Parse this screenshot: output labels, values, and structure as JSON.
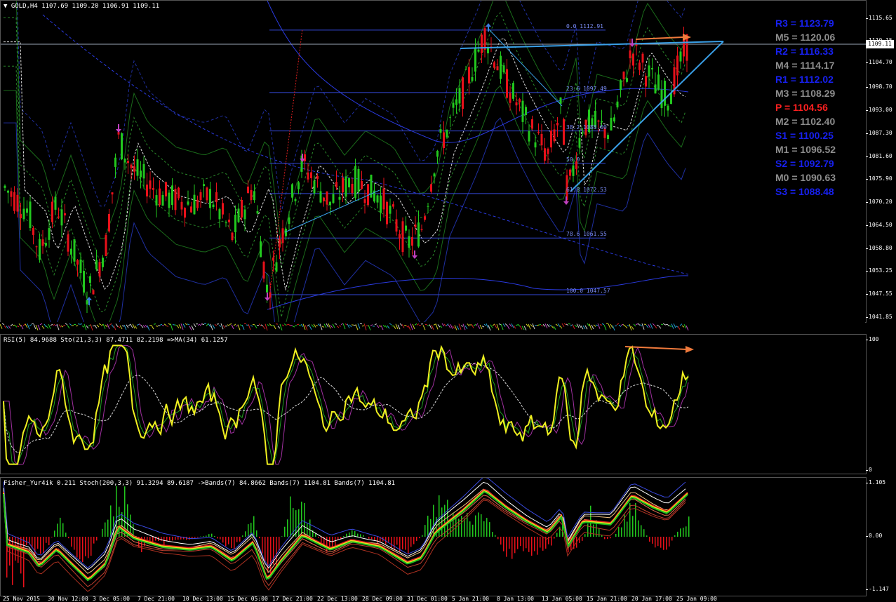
{
  "chart": {
    "symbol_header": "GOLD,H4  1107.69 1109.20 1106.91 1109.11",
    "current_price": "1109.11",
    "price_axis": [
      "1115.65",
      "1110.15",
      "1104.70",
      "1098.70",
      "1093.00",
      "1087.30",
      "1081.60",
      "1075.90",
      "1070.20",
      "1064.50",
      "1058.80",
      "1053.25",
      "1047.55",
      "1041.85"
    ],
    "fib_levels": [
      {
        "label": "0.0 1112.91",
        "price": 1112.91
      },
      {
        "label": "23.6 1097.49",
        "price": 1097.49
      },
      {
        "label": "38.2 1088.00",
        "price": 1088.0
      },
      {
        "label": "50.0",
        "price": 1080.0
      },
      {
        "label": "61.8 1072.53",
        "price": 1072.53
      },
      {
        "label": "78.6 1061.55",
        "price": 1061.55
      },
      {
        "label": "100.0 1047.57",
        "price": 1047.57
      }
    ],
    "colors": {
      "bull": "#22c81e",
      "bear": "#e8111a",
      "fib": "#3448d8",
      "trend": "#3aa0e8",
      "arrow": "#f07a3c",
      "pivot_r": "#1720f0",
      "pivot_m": "#8d8d8d",
      "pivot_p": "#ff2020"
    }
  },
  "pivots": [
    {
      "label": "R3 = 1123.79",
      "type": "r"
    },
    {
      "label": "M5 = 1120.06",
      "type": "m"
    },
    {
      "label": "R2 = 1116.33",
      "type": "r"
    },
    {
      "label": "M4 = 1114.17",
      "type": "m"
    },
    {
      "label": "R1 = 1112.02",
      "type": "r"
    },
    {
      "label": "M3 = 1108.29",
      "type": "m"
    },
    {
      "label": "P   = 1104.56",
      "type": "p"
    },
    {
      "label": "M2 = 1102.40",
      "type": "m"
    },
    {
      "label": "S1 = 1100.25",
      "type": "r"
    },
    {
      "label": "M1 = 1096.52",
      "type": "m"
    },
    {
      "label": "S2 = 1092.79",
      "type": "r"
    },
    {
      "label": "M0 = 1090.63",
      "type": "m"
    },
    {
      "label": "S3 = 1088.48",
      "type": "r"
    }
  ],
  "rsi": {
    "header": "RSI(5) 84.9688  Sto(21,3,3) 87.4711 82.2198  =>MA(34) 61.1257",
    "axis_top": "100",
    "axis_bottom": "0"
  },
  "fisher": {
    "header": "Fisher_Yur4ik 0.211  Stoch(200,3,3) 91.3294 89.6187  ->Bands(7) 84.8662  Bands(7) 1104.81  Bands(7) 1104.81",
    "axis": [
      "1.105",
      "0.00",
      "-1.147"
    ]
  },
  "time_axis": [
    "25 Nov 2015",
    "30 Nov 12:00",
    "3 Dec 05:00",
    "7 Dec 21:00",
    "10 Dec 13:00",
    "15 Dec 05:00",
    "17 Dec 21:00",
    "22 Dec 13:00",
    "28 Dec 09:00",
    "31 Dec 01:00",
    "5 Jan 21:00",
    "8 Jan 13:00",
    "13 Jan 05:00",
    "15 Jan 21:00",
    "20 Jan 17:00",
    "25 Jan 09:00"
  ]
}
